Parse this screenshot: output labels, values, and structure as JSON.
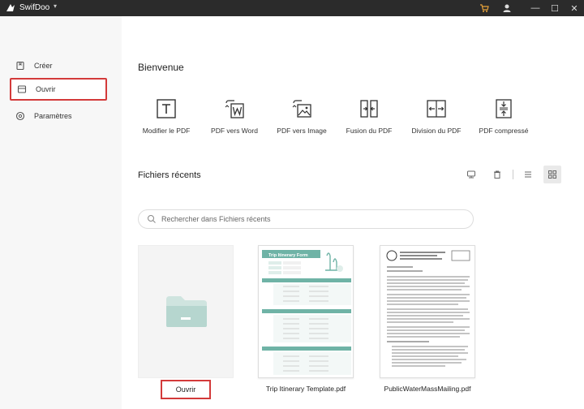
{
  "titlebar": {
    "app_name": "SwifDoo",
    "caret": "▾",
    "minimize": "—",
    "maximize": "☐",
    "close": "✕"
  },
  "sidebar": {
    "items": [
      {
        "label": "Créer",
        "icon": "create-icon"
      },
      {
        "label": "Ouvrir",
        "icon": "open-file-icon"
      },
      {
        "label": "Paramètres",
        "icon": "settings-gear-icon"
      }
    ]
  },
  "main": {
    "welcome": "Bienvenue",
    "tools": [
      {
        "label": "Modifier le PDF",
        "icon": "edit-text-icon"
      },
      {
        "label": "PDF vers Word",
        "icon": "word-icon"
      },
      {
        "label": "PDF vers Image",
        "icon": "image-icon"
      },
      {
        "label": "Fusion du PDF",
        "icon": "merge-icon"
      },
      {
        "label": "Division du PDF",
        "icon": "split-icon"
      },
      {
        "label": "PDF compressé",
        "icon": "compress-icon"
      }
    ],
    "recent_title": "Fichiers récents",
    "search_placeholder": "Rechercher dans Fichiers récents",
    "files": [
      {
        "label": "Trip Itinerary Template.pdf",
        "thumb_title": "Trip Itinerary Form"
      },
      {
        "label": "PublicWaterMassMailing.pdf"
      }
    ],
    "open_button": "Ouvrir"
  },
  "colors": {
    "highlight": "#d33a3a",
    "accent_green": "#5aa89a",
    "folder": "#cfe4df"
  }
}
